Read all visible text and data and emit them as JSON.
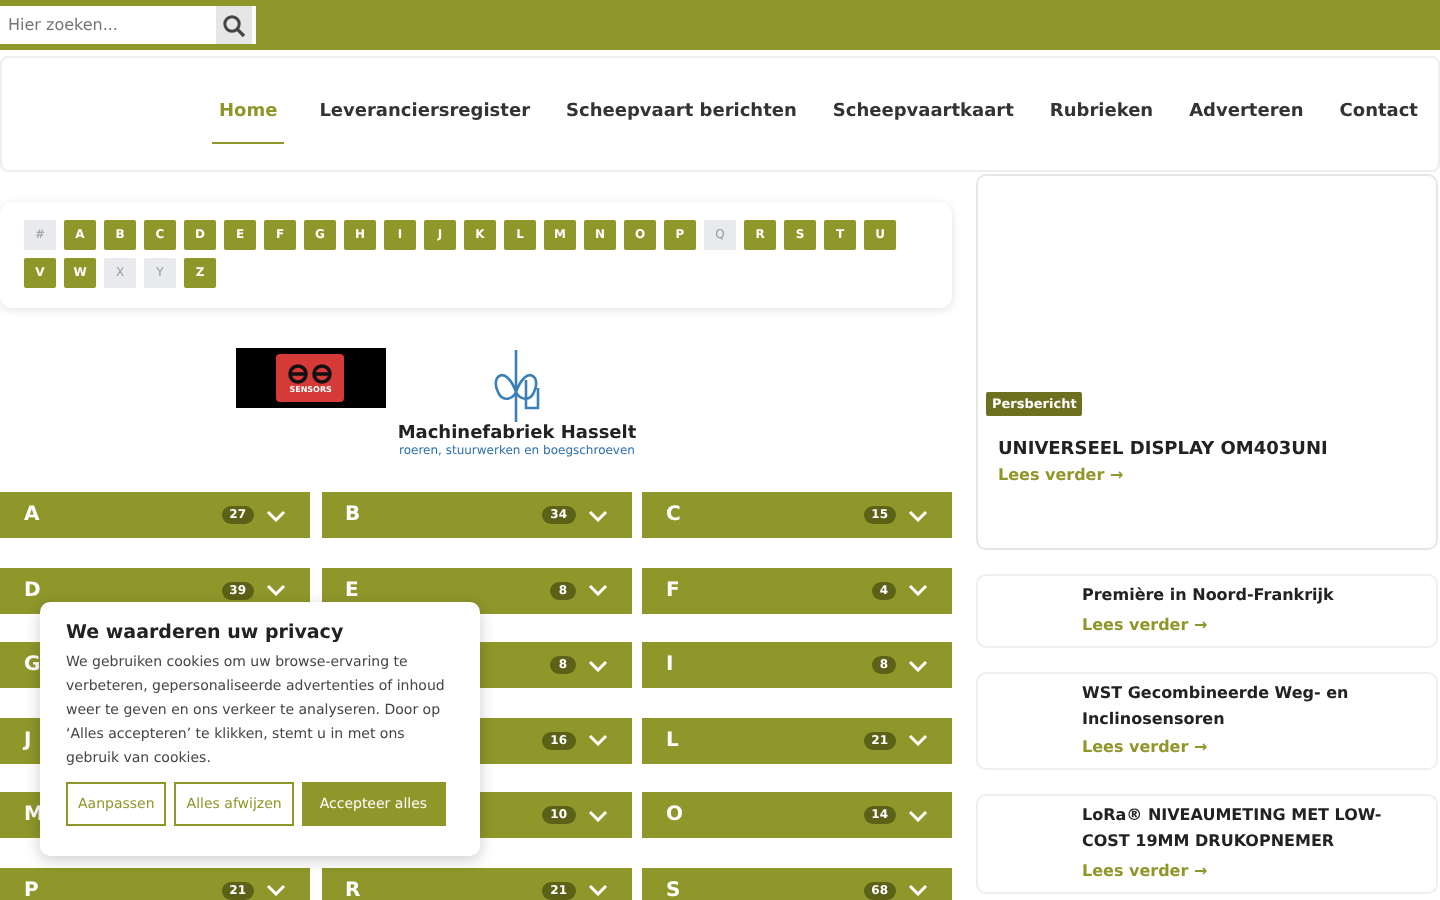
{
  "search": {
    "placeholder": "Hier zoeken..."
  },
  "nav": [
    {
      "label": "Home",
      "selected": true
    },
    {
      "label": "Leveranciersregister",
      "selected": false
    },
    {
      "label": "Scheepvaart berichten",
      "selected": false
    },
    {
      "label": "Scheepvaartkaart",
      "selected": false
    },
    {
      "label": "Rubrieken",
      "selected": false
    },
    {
      "label": "Adverteren",
      "selected": false
    },
    {
      "label": "Contact",
      "selected": false
    }
  ],
  "letters": [
    {
      "label": "#",
      "disabled": true
    },
    {
      "label": "A",
      "disabled": false
    },
    {
      "label": "B",
      "disabled": false
    },
    {
      "label": "C",
      "disabled": false
    },
    {
      "label": "D",
      "disabled": false
    },
    {
      "label": "E",
      "disabled": false
    },
    {
      "label": "F",
      "disabled": false
    },
    {
      "label": "G",
      "disabled": false
    },
    {
      "label": "H",
      "disabled": false
    },
    {
      "label": "I",
      "disabled": false
    },
    {
      "label": "J",
      "disabled": false
    },
    {
      "label": "K",
      "disabled": false
    },
    {
      "label": "L",
      "disabled": false
    },
    {
      "label": "M",
      "disabled": false
    },
    {
      "label": "N",
      "disabled": false
    },
    {
      "label": "O",
      "disabled": false
    },
    {
      "label": "P",
      "disabled": false
    },
    {
      "label": "Q",
      "disabled": true
    },
    {
      "label": "R",
      "disabled": false
    },
    {
      "label": "S",
      "disabled": false
    },
    {
      "label": "T",
      "disabled": false
    },
    {
      "label": "U",
      "disabled": false
    },
    {
      "label": "V",
      "disabled": false
    },
    {
      "label": "W",
      "disabled": false
    },
    {
      "label": "X",
      "disabled": true
    },
    {
      "label": "Y",
      "disabled": true
    },
    {
      "label": "Z",
      "disabled": false
    }
  ],
  "sponsors": [
    {
      "kind": "sensor-logo",
      "caption": "SENSORS"
    },
    {
      "kind": "machine-logo",
      "name": "Machinefabriek Hasselt",
      "tagline": "roeren, stuurwerken en boegschroeven"
    }
  ],
  "groups": [
    {
      "letter": "A",
      "count": "27"
    },
    {
      "letter": "B",
      "count": "34"
    },
    {
      "letter": "C",
      "count": "15"
    },
    {
      "letter": "D",
      "count": "39"
    },
    {
      "letter": "E",
      "count": "8"
    },
    {
      "letter": "F",
      "count": "4"
    },
    {
      "letter": "G"
    },
    {
      "count": "8"
    },
    {
      "letter": "I",
      "count": "8"
    },
    {
      "letter": "J"
    },
    {
      "count": "16"
    },
    {
      "letter": "L",
      "count": "21"
    },
    {
      "letter": "M"
    },
    {
      "count": "10"
    },
    {
      "letter": "O",
      "count": "14"
    },
    {
      "letter": "P",
      "count": "21"
    },
    {
      "letter": "R",
      "count": "21"
    },
    {
      "letter": "S",
      "count": "68"
    }
  ],
  "featured": {
    "badge": "Persbericht",
    "title": "UNIVERSEEL DISPLAY OM403UNI",
    "link": "Lees verder →"
  },
  "news": [
    {
      "title": "Première in Noord-Frankrijk",
      "link": "Lees verder →"
    },
    {
      "title": "WST Gecombineerde Weg- en Inclinosensoren",
      "link": "Lees verder →"
    },
    {
      "title": "LoRa® NIVEAUMETING MET LOW-COST 19MM DRUKOPNEMER",
      "link": "Lees verder →"
    }
  ],
  "cookie": {
    "title": "We waarderen uw privacy",
    "text": "We gebruiken cookies om uw browse-ervaring te verbeteren, gepersonaliseerde advertenties of inhoud weer te geven en ons verkeer te analyseren. Door op ‘Alles accepteren’ te klikken, stemt u in met ons gebruik van cookies.",
    "buttons": [
      {
        "label": "Aanpassen",
        "kind": "outline"
      },
      {
        "label": "Alles afwijzen",
        "kind": "outline"
      },
      {
        "label": "Accepteer alles",
        "kind": "filled"
      }
    ]
  }
}
